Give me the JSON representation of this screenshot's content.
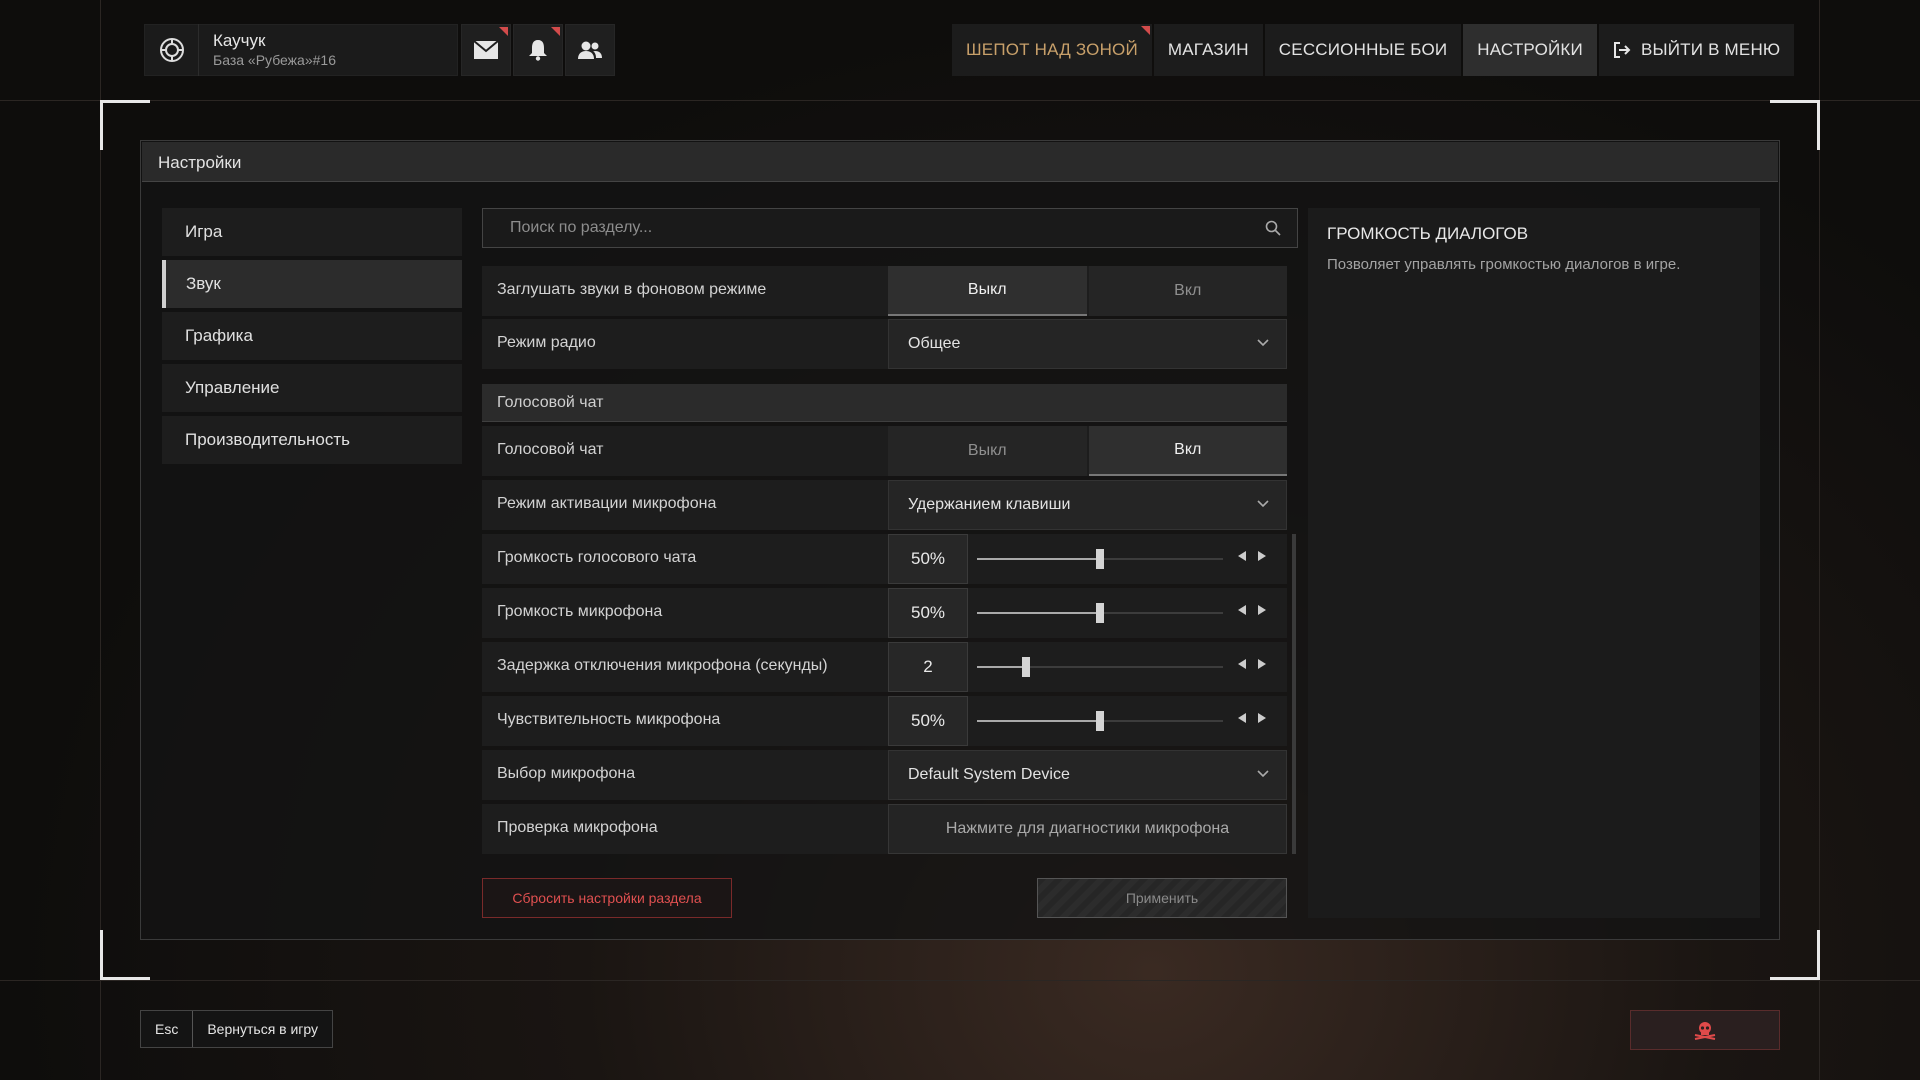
{
  "profile": {
    "nickname": "Каучук",
    "base": "База «Рубежа»#16"
  },
  "nav": {
    "whisper": "ШЕПОТ НАД ЗОНОЙ",
    "shop": "МАГАЗИН",
    "session": "СЕССИОННЫЕ БОИ",
    "settings": "НАСТРОЙКИ",
    "exit": "ВЫЙТИ В МЕНЮ"
  },
  "panel": {
    "title": "Настройки"
  },
  "sidebar": {
    "items": [
      {
        "label": "Игра"
      },
      {
        "label": "Звук"
      },
      {
        "label": "Графика"
      },
      {
        "label": "Управление"
      },
      {
        "label": "Производительность"
      }
    ],
    "active": "Звук"
  },
  "search": {
    "placeholder": "Поиск по разделу..."
  },
  "settings": {
    "mute_bg": {
      "label": "Заглушать звуки в фоновом режиме",
      "off": "Выкл",
      "on": "Вкл",
      "selected": "Выкл"
    },
    "radio_mode": {
      "label": "Режим радио",
      "value": "Общее"
    },
    "voice_section": "Голосовой чат",
    "voice_chat": {
      "label": "Голосовой чат",
      "off": "Выкл",
      "on": "Вкл",
      "selected": "Вкл"
    },
    "mic_activation": {
      "label": "Режим активации микрофона",
      "value": "Удержанием клавиши"
    },
    "voice_volume": {
      "label": "Громкость голосового чата",
      "display": "50%",
      "fraction": 0.5
    },
    "mic_volume": {
      "label": "Громкость микрофона",
      "display": "50%",
      "fraction": 0.5
    },
    "mic_delay": {
      "label": "Задержка отключения микрофона (секунды)",
      "display": "2",
      "fraction": 0.2
    },
    "mic_sensitivity": {
      "label": "Чувствительность микрофона",
      "display": "50%",
      "fraction": 0.5
    },
    "mic_select": {
      "label": "Выбор микрофона",
      "value": "Default System Device"
    },
    "mic_check": {
      "label": "Проверка микрофона",
      "button": "Нажмите для диагностики микрофона"
    }
  },
  "actions": {
    "reset": "Сбросить настройки раздела",
    "apply": "Применить"
  },
  "info": {
    "title": "ГРОМКОСТЬ ДИАЛОГОВ",
    "description": "Позволяет управлять громкостью диалогов в игре."
  },
  "footer": {
    "esc_key": "Esc",
    "back": "Вернуться в игру"
  },
  "colors": {
    "accent_red": "#d24b4b",
    "whisper": "#c8a06a"
  },
  "icons": [
    "emblem-icon",
    "mail-icon",
    "bell-icon",
    "friends-icon",
    "exit-icon",
    "search-icon",
    "chevron-down-icon",
    "arrow-left-icon",
    "arrow-right-icon",
    "skull-icon"
  ]
}
